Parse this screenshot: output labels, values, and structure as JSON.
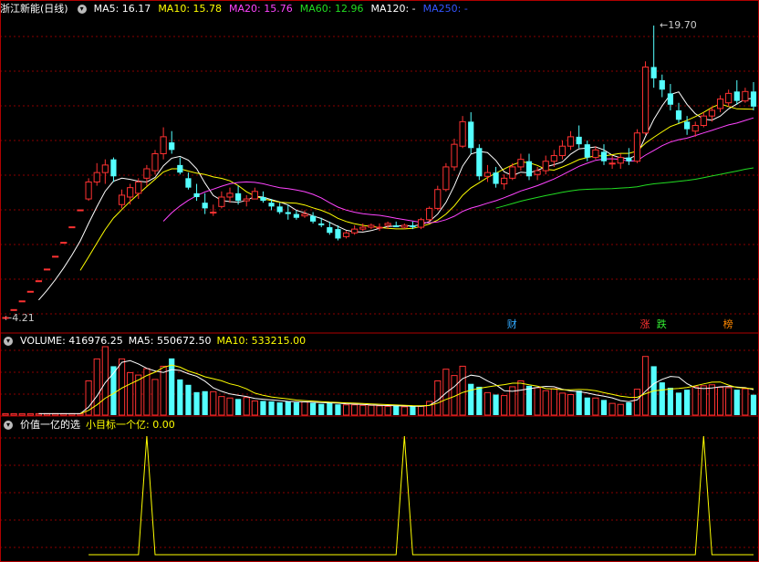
{
  "price_panel": {
    "title": "浙江新能(日线)",
    "ma_labels": [
      {
        "text": "MA5: 16.17",
        "color": "#ffffff"
      },
      {
        "text": "MA10: 15.78",
        "color": "#ffff00"
      },
      {
        "text": "MA20: 15.76",
        "color": "#ff44ff"
      },
      {
        "text": "MA60: 12.96",
        "color": "#22dd22"
      },
      {
        "text": "MA120: -",
        "color": "#ffffff"
      },
      {
        "text": "MA250: -",
        "color": "#3355ff"
      }
    ],
    "high_label": "19.70",
    "low_label": "4.21",
    "event_tags": [
      {
        "text": "财",
        "color": "#33aaff",
        "index": 61
      },
      {
        "text": "涨",
        "color": "#ff3333",
        "index": 77
      },
      {
        "text": "跌",
        "color": "#33ee33",
        "index": 79
      },
      {
        "text": "榜",
        "color": "#ff8800",
        "index": 87
      }
    ]
  },
  "volume_panel": {
    "labels": [
      {
        "text": "VOLUME: 416976.25",
        "color": "#ffffff"
      },
      {
        "text": "MA5: 550672.50",
        "color": "#ffffff"
      },
      {
        "text": "MA10: 533215.00",
        "color": "#ffff00"
      }
    ]
  },
  "indicator_panel": {
    "labels": [
      {
        "text": "价值一亿的选",
        "color": "#ffffff"
      },
      {
        "text": "小目标一个亿: 0.00",
        "color": "#ffff00"
      }
    ]
  },
  "chart_data": {
    "type": "candlestick",
    "price_range": [
      4.21,
      19.7
    ],
    "candles": [
      [
        4.21,
        4.21,
        4.21,
        4.21
      ],
      [
        4.63,
        4.63,
        4.63,
        4.63
      ],
      [
        5.09,
        5.09,
        5.09,
        5.09
      ],
      [
        5.6,
        5.6,
        5.6,
        5.6
      ],
      [
        6.16,
        6.16,
        6.16,
        6.16
      ],
      [
        6.78,
        6.78,
        6.78,
        6.78
      ],
      [
        7.46,
        7.46,
        7.46,
        7.46
      ],
      [
        8.2,
        8.2,
        8.2,
        8.2
      ],
      [
        9.02,
        9.02,
        9.02,
        9.02
      ],
      [
        9.92,
        9.92,
        9.92,
        9.92
      ],
      [
        10.5,
        11.6,
        10.4,
        11.4
      ],
      [
        11.4,
        12.4,
        11.2,
        11.9
      ],
      [
        11.9,
        12.6,
        11.3,
        12.3
      ],
      [
        12.6,
        12.7,
        11.4,
        11.7
      ],
      [
        10.2,
        11.0,
        10.0,
        10.7
      ],
      [
        10.6,
        11.3,
        10.2,
        11.1
      ],
      [
        10.8,
        11.6,
        10.5,
        11.4
      ],
      [
        11.6,
        12.3,
        11.2,
        12.1
      ],
      [
        12.0,
        13.1,
        11.8,
        12.9
      ],
      [
        12.9,
        14.3,
        12.6,
        13.8
      ],
      [
        13.5,
        14.1,
        12.9,
        13.1
      ],
      [
        12.3,
        12.7,
        11.8,
        11.9
      ],
      [
        11.6,
        11.9,
        11.0,
        11.1
      ],
      [
        10.8,
        11.3,
        10.4,
        10.6
      ],
      [
        10.3,
        10.8,
        9.7,
        10.0
      ],
      [
        9.8,
        10.2,
        9.6,
        9.8
      ],
      [
        10.1,
        10.9,
        10.0,
        10.6
      ],
      [
        10.6,
        11.1,
        10.3,
        10.8
      ],
      [
        10.8,
        11.2,
        10.2,
        10.4
      ],
      [
        10.4,
        10.7,
        10.1,
        10.5
      ],
      [
        10.5,
        11.1,
        10.5,
        10.9
      ],
      [
        10.6,
        10.9,
        10.3,
        10.4
      ],
      [
        10.3,
        10.5,
        9.9,
        10.1
      ],
      [
        10.1,
        10.3,
        9.7,
        9.8
      ],
      [
        9.8,
        10.2,
        9.4,
        9.7
      ],
      [
        9.7,
        9.9,
        9.4,
        9.5
      ],
      [
        9.6,
        9.9,
        9.5,
        9.7
      ],
      [
        9.6,
        9.8,
        9.2,
        9.3
      ],
      [
        9.2,
        9.5,
        9.0,
        9.1
      ],
      [
        9.0,
        9.3,
        8.6,
        8.7
      ],
      [
        8.9,
        9.1,
        8.3,
        8.4
      ],
      [
        8.5,
        8.8,
        8.4,
        8.7
      ],
      [
        8.7,
        9.1,
        8.6,
        8.9
      ],
      [
        8.9,
        9.2,
        8.8,
        9.0
      ],
      [
        9.0,
        9.2,
        8.9,
        9.1
      ],
      [
        9.0,
        9.2,
        8.8,
        9.0
      ],
      [
        9.1,
        9.3,
        8.9,
        9.2
      ],
      [
        9.1,
        9.3,
        9.0,
        9.0
      ],
      [
        9.0,
        9.2,
        8.9,
        9.1
      ],
      [
        9.1,
        9.3,
        8.9,
        9.0
      ],
      [
        9.0,
        9.5,
        8.9,
        9.4
      ],
      [
        9.4,
        10.1,
        9.3,
        10.0
      ],
      [
        10.0,
        11.2,
        9.9,
        11.0
      ],
      [
        11.0,
        12.4,
        10.9,
        12.2
      ],
      [
        12.2,
        13.7,
        12.0,
        13.4
      ],
      [
        13.3,
        14.9,
        13.2,
        14.6
      ],
      [
        14.6,
        15.1,
        12.9,
        13.2
      ],
      [
        13.2,
        13.4,
        11.5,
        11.7
      ],
      [
        11.7,
        12.3,
        11.4,
        11.9
      ],
      [
        11.9,
        12.2,
        11.1,
        11.3
      ],
      [
        11.3,
        11.8,
        11.0,
        11.6
      ],
      [
        11.6,
        12.4,
        11.5,
        12.2
      ],
      [
        12.2,
        12.9,
        12.0,
        12.6
      ],
      [
        12.5,
        12.9,
        11.5,
        11.7
      ],
      [
        11.8,
        12.2,
        11.5,
        12.0
      ],
      [
        12.0,
        12.8,
        11.8,
        12.5
      ],
      [
        12.5,
        13.1,
        12.2,
        12.8
      ],
      [
        12.8,
        13.6,
        12.6,
        13.3
      ],
      [
        13.3,
        14.1,
        13.1,
        13.8
      ],
      [
        13.8,
        14.4,
        13.2,
        13.4
      ],
      [
        13.4,
        13.6,
        12.5,
        12.7
      ],
      [
        12.7,
        13.3,
        12.6,
        13.1
      ],
      [
        13.0,
        13.4,
        12.3,
        12.5
      ],
      [
        12.4,
        12.8,
        12.1,
        12.4
      ],
      [
        12.4,
        12.9,
        12.1,
        12.7
      ],
      [
        12.7,
        13.2,
        12.3,
        12.5
      ],
      [
        12.5,
        14.2,
        12.4,
        14.0
      ],
      [
        14.0,
        17.8,
        13.9,
        17.5
      ],
      [
        17.5,
        19.7,
        16.4,
        16.9
      ],
      [
        16.8,
        17.1,
        15.9,
        16.3
      ],
      [
        16.1,
        16.6,
        15.2,
        15.5
      ],
      [
        15.2,
        15.6,
        14.5,
        14.7
      ],
      [
        14.6,
        14.9,
        13.9,
        14.2
      ],
      [
        14.1,
        14.6,
        13.8,
        14.4
      ],
      [
        14.4,
        15.1,
        14.3,
        14.9
      ],
      [
        14.9,
        15.4,
        14.6,
        15.2
      ],
      [
        15.3,
        16.0,
        15.1,
        15.8
      ],
      [
        15.6,
        16.3,
        15.4,
        16.1
      ],
      [
        16.2,
        16.8,
        15.5,
        15.7
      ],
      [
        15.7,
        16.4,
        15.6,
        16.2
      ],
      [
        16.2,
        16.7,
        15.2,
        15.4
      ]
    ],
    "volume_range": [
      0,
      1400000
    ],
    "volume": [
      30000,
      30000,
      30000,
      30000,
      30000,
      30000,
      30000,
      30000,
      30000,
      30000,
      700000,
      1150000,
      1400000,
      1000000,
      1150000,
      870000,
      820000,
      950000,
      730000,
      1000000,
      1160000,
      730000,
      620000,
      470000,
      490000,
      480000,
      380000,
      350000,
      330000,
      360000,
      290000,
      290000,
      280000,
      260000,
      280000,
      260000,
      270000,
      250000,
      230000,
      250000,
      220000,
      210000,
      210000,
      200000,
      200000,
      190000,
      180000,
      190000,
      170000,
      180000,
      180000,
      280000,
      700000,
      940000,
      810000,
      1000000,
      640000,
      580000,
      460000,
      420000,
      400000,
      580000,
      700000,
      600000,
      560000,
      500000,
      540000,
      450000,
      420000,
      500000,
      360000,
      350000,
      310000,
      240000,
      220000,
      260000,
      530000,
      1200000,
      1000000,
      670000,
      560000,
      460000,
      520000,
      580000,
      600000,
      620000,
      570000,
      560000,
      520000,
      540000,
      417000
    ],
    "signal_peaks": [
      17,
      48,
      84
    ]
  }
}
